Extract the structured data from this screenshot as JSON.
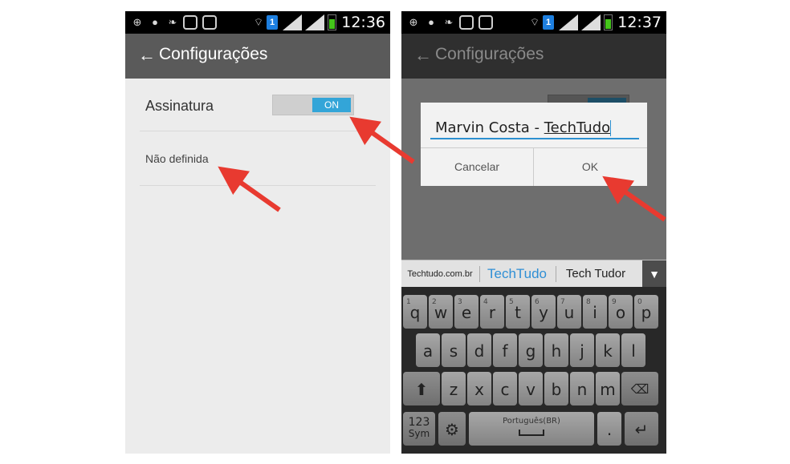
{
  "left": {
    "status": {
      "time": "12:36"
    },
    "actionbar": {
      "back_glyph": "←",
      "title": "Configurações"
    },
    "signature_row": {
      "label": "Assinatura",
      "toggle_label": "ON"
    },
    "signature_value": "Não definida"
  },
  "right": {
    "status": {
      "time": "12:37"
    },
    "actionbar": {
      "back_glyph": "←",
      "title": "Configurações"
    },
    "dialog": {
      "input_prefix": "Marvin Costa - ",
      "input_word": "TechTudo",
      "cancel": "Cancelar",
      "ok": "OK"
    },
    "suggestions": [
      "Techtudo.com.br",
      "TechTudo",
      "Tech Tudor"
    ],
    "keyboard": {
      "row1": [
        "q",
        "w",
        "e",
        "r",
        "t",
        "y",
        "u",
        "i",
        "o",
        "p"
      ],
      "row1_hints": [
        "1",
        "2",
        "3",
        "4",
        "5",
        "6",
        "7",
        "8",
        "9",
        "0"
      ],
      "row2": [
        "a",
        "s",
        "d",
        "f",
        "g",
        "h",
        "j",
        "k",
        "l"
      ],
      "row3": [
        "z",
        "x",
        "c",
        "v",
        "b",
        "n",
        "m"
      ],
      "sym_top": "123",
      "sym_bottom": "Sym",
      "space_label": "Português(BR)",
      "period": "."
    }
  },
  "colors": {
    "toggle_on": "#33a5d8",
    "dialog_accent": "#2c90d0",
    "arrow": "#e83a30",
    "actionbar": "#5a5a5a"
  },
  "icons": [
    "back-arrow-icon",
    "gear-icon",
    "shift-icon",
    "backspace-icon",
    "enter-icon",
    "chevron-down-icon",
    "wifi-icon",
    "signal-icon",
    "battery-icon"
  ]
}
